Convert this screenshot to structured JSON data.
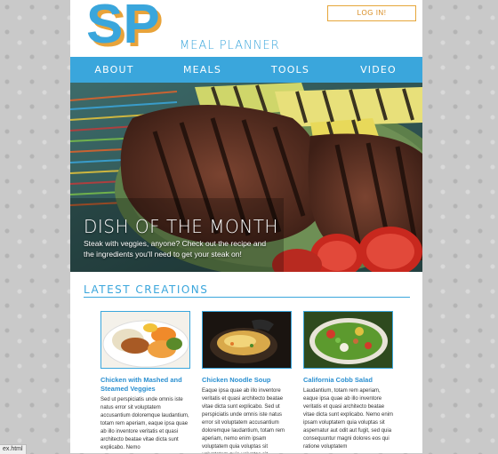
{
  "header": {
    "logo_text": "SP",
    "logo_sub": "MEAL PLANNER",
    "login_label": "LOG IN!"
  },
  "nav": {
    "items": [
      "ABOUT",
      "MEALS",
      "TOOLS",
      "VIDEO"
    ]
  },
  "hero": {
    "title": "DISH OF THE MONTH",
    "caption": "Steak with veggies, anyone? Check out the recipe and the ingredients you'll need to get your steak on!"
  },
  "latest": {
    "title": "LATEST CREATIONS",
    "cards": [
      {
        "title": "Chicken with Mashed and Steamed Veggies",
        "text": "Sed ut perspiciatis unde omnis iste natus error sit voluptatem accusantium doloremque laudantium, totam rem aperiam, eaque ipsa quae ab illo inventore veritatis et quasi architecto beatae vitae dicta sunt explicabo. Nemo"
      },
      {
        "title": "Chicken Noodle Soup",
        "text": "Eaque ipsa quae ab illo inventore veritatis et quasi architecto beatae vitae dicta sunt explicabo. Sed ut perspiciatis unde omnis iste natus error sit voluptatem accusantium doloremque laudantium, totam rem aperiam, nemo enim ipsam voluptatem quia voluptas sit voluptatem quia voluptas sit"
      },
      {
        "title": "California Cobb Salad",
        "text": "Laudantium, totam rem aperiam, eaque ipsa quae ab illo inventore veritatis et quasi architecto beatae vitae dicta sunt explicabo. Nemo enim ipsam voluptatem quia voluptas sit aspernatur aut odit aut fugit, sed quia consequuntur magni dolores eos qui ratione voluptatem"
      }
    ]
  },
  "statusbar": {
    "text": "ex.html"
  },
  "colors": {
    "accent": "#3aa6dc",
    "logo_orange": "#e8a33a",
    "login_border": "#e6a63a"
  }
}
